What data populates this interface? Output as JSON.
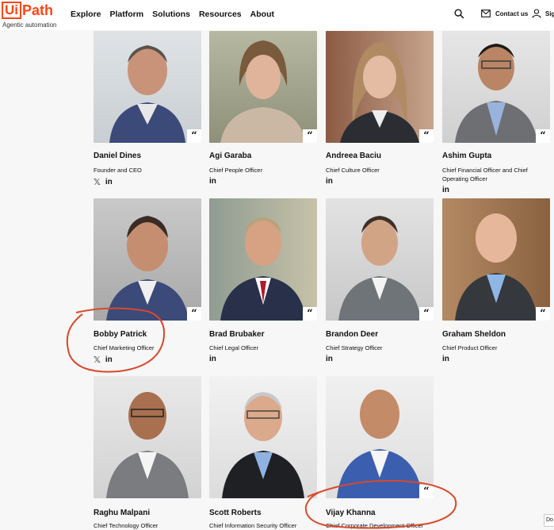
{
  "header": {
    "logo_ui": "Ui",
    "logo_path": "Path",
    "logo_tagline": "Agentic automation",
    "nav": [
      "Explore",
      "Platform",
      "Solutions",
      "Resources",
      "About"
    ],
    "contact": "Contact us",
    "sign": "Sig"
  },
  "quote_glyph": "“",
  "x_glyph": "𝕏",
  "in_glyph": "in",
  "people": [
    {
      "name": "Daniel Dines",
      "title": "Founder and CEO"
    },
    {
      "name": "Agi Garaba",
      "title": "Chief People Officer"
    },
    {
      "name": "Andreea Baciu",
      "title": "Chief Culture Officer"
    },
    {
      "name": "Ashim Gupta",
      "title": "Chief Financial Officer and Chief Operating Officer"
    },
    {
      "name": "Bobby Patrick",
      "title": "Chief Marketing Officer"
    },
    {
      "name": "Brad Brubaker",
      "title": "Chief Legal Officer"
    },
    {
      "name": "Brandon Deer",
      "title": "Chief Strategy Officer"
    },
    {
      "name": "Graham Sheldon",
      "title": "Chief Product Officer"
    },
    {
      "name": "Raghu Malpani",
      "title": "Chief Technology Officer"
    },
    {
      "name": "Scott Roberts",
      "title": "Chief Information Security Officer"
    },
    {
      "name": "Vijay Khanna",
      "title": "Chief Corporate Development Officer"
    }
  ],
  "do_button": "Do"
}
